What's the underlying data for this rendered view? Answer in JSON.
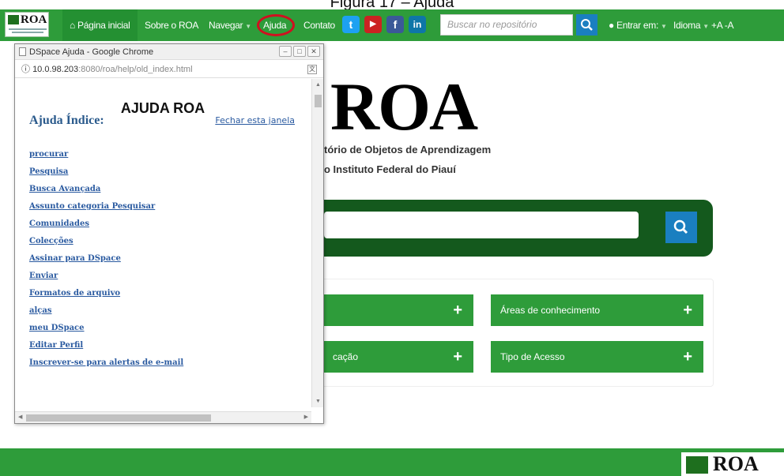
{
  "caption": "Figura 17 – Ajuda",
  "navbar": {
    "logo_text": "ROA",
    "home_label": "Página inicial",
    "about_label": "Sobre o ROA",
    "browse_label": "Navegar",
    "help_label": "Ajuda",
    "contact_label": "Contato",
    "search_placeholder": "Buscar no repositório",
    "login_label": "Entrar em:",
    "language_label": "Idioma",
    "font_size_label": "+A -A",
    "highlight_color": "#d01020"
  },
  "social": [
    {
      "icon": "twitter-icon",
      "color": "#1da1f2",
      "glyph": "t"
    },
    {
      "icon": "youtube-icon",
      "color": "#cc2222",
      "glyph": "▶"
    },
    {
      "icon": "facebook-icon",
      "color": "#3b5998",
      "glyph": "f"
    },
    {
      "icon": "linkedin-icon",
      "color": "#0e76a8",
      "glyph": "in"
    }
  ],
  "background": {
    "big_logo": "ROA",
    "tagline_1": "tório de Objetos de Aprendizagem",
    "tagline_2": "o Instituto Federal do Piauí",
    "cards": [
      {
        "label": ""
      },
      {
        "label": "Áreas de conhecimento"
      },
      {
        "label": "cação"
      },
      {
        "label": "Tipo de Acesso"
      }
    ]
  },
  "popup": {
    "window_title": "DSpace Ajuda - Google Chrome",
    "url_prefix": "10.0.98.203",
    "url_rest": ":8080/roa/help/old_index.html",
    "heading": "AJUDA ROA",
    "index_title": "Ajuda Índice:",
    "close_link": "Fechar esta janela",
    "links": [
      "procurar",
      "Pesquisa",
      "Busca Avançada",
      "Assunto categoria Pesquisar",
      "Comunidades",
      "Colecções",
      "Assinar para DSpace",
      "Enviar",
      "Formatos de arquivo",
      "alças",
      "meu DSpace",
      "Editar Perfil",
      "Inscrever-se para alertas de e-mail"
    ]
  },
  "footer": {
    "logo_text": "ROA"
  },
  "colors": {
    "brand_green": "#2e9c3a",
    "dark_green": "#14591d",
    "search_blue": "#1a7fc0",
    "link_blue": "#2a5aa0"
  }
}
